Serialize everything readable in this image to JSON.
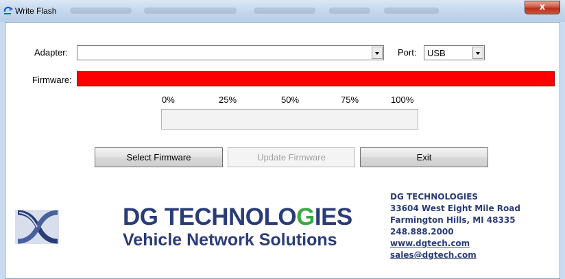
{
  "window": {
    "title": "Write Flash",
    "close_label": "x"
  },
  "form": {
    "adapter_label": "Adapter:",
    "adapter_value": "",
    "port_label": "Port:",
    "port_value": "USB",
    "firmware_label": "Firmware:",
    "firmware_status_color": "#ff0000"
  },
  "progress": {
    "ticks": [
      "0%",
      "25%",
      "50%",
      "75%",
      "100%"
    ],
    "value_percent": 0
  },
  "buttons": {
    "select_firmware": "Select Firmware",
    "update_firmware": "Update Firmware",
    "exit": "Exit"
  },
  "logo": {
    "title_part1": "DG TECHNOLO",
    "title_g": "G",
    "title_part2": "IES",
    "subtitle": "Vehicle Network Solutions",
    "brand_color": "#2a3c78",
    "accent_color": "#3aa843"
  },
  "contact": {
    "company": "DG TECHNOLOGIES",
    "street": "33604 West Eight Mile Road",
    "city": "Farmington Hills, MI 48335",
    "phone": "248.888.2000",
    "website": "www.dgtech.com",
    "email": "sales@dgtech.com"
  }
}
